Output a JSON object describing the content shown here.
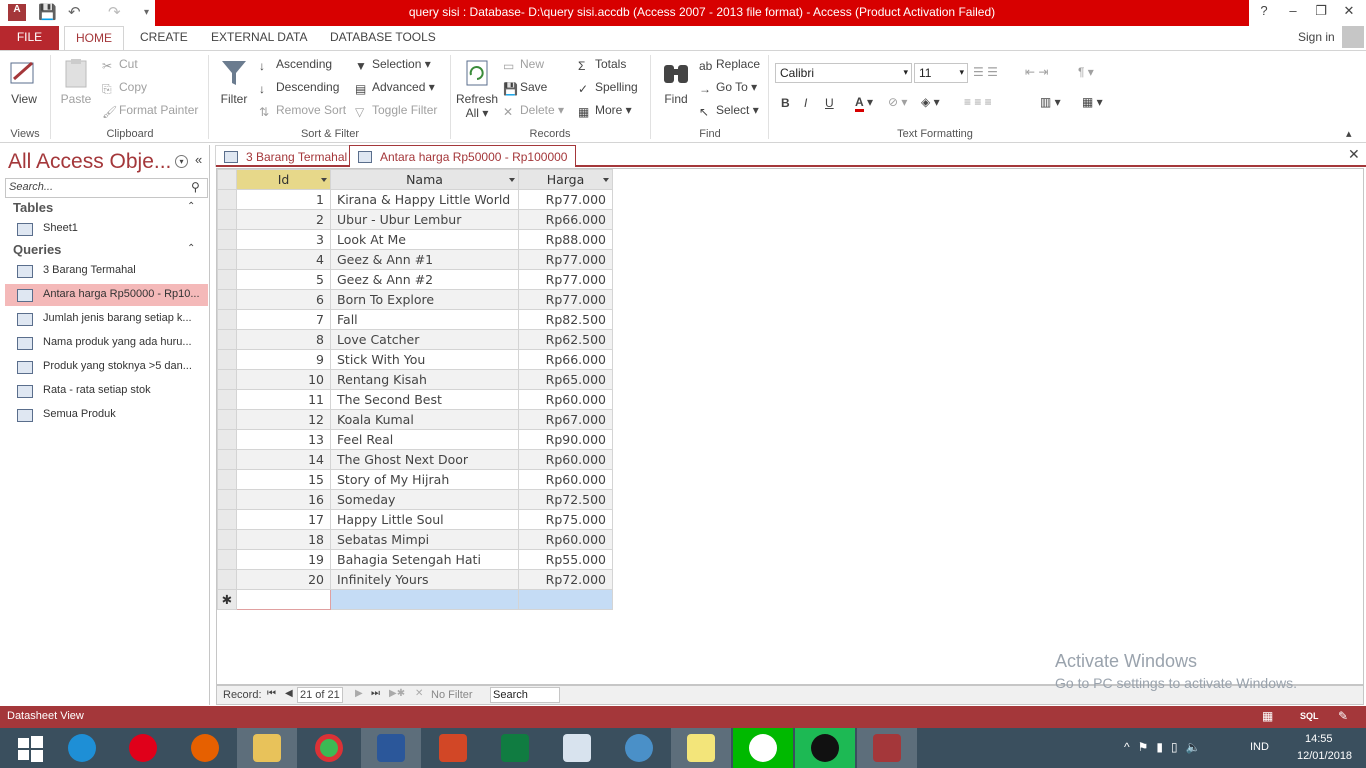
{
  "title_bar": {
    "title": "query sisi : Database- D:\\query sisi.accdb (Access 2007 - 2013 file format) -  Access (Product Activation Failed)",
    "help": "?",
    "minimize": "–",
    "restore": "❐",
    "close": "✕"
  },
  "tabs": {
    "file": "FILE",
    "home": "HOME",
    "create": "CREATE",
    "external": "EXTERNAL DATA",
    "dbtools": "DATABASE TOOLS",
    "signin": "Sign in"
  },
  "ribbon": {
    "views": {
      "view": "View",
      "label": "Views"
    },
    "clipboard": {
      "paste": "Paste",
      "cut": "Cut",
      "copy": "Copy",
      "format_painter": "Format Painter",
      "label": "Clipboard"
    },
    "sortfilter": {
      "filter": "Filter",
      "ascending": "Ascending",
      "descending": "Descending",
      "remove_sort": "Remove Sort",
      "selection": "Selection",
      "advanced": "Advanced",
      "toggle_filter": "Toggle Filter",
      "label": "Sort & Filter"
    },
    "records": {
      "refresh": "Refresh",
      "refresh_all": "All",
      "new": "New",
      "save": "Save",
      "delete": "Delete",
      "totals": "Totals",
      "spelling": "Spelling",
      "more": "More",
      "label": "Records"
    },
    "find": {
      "find": "Find",
      "replace": "Replace",
      "goto": "Go To",
      "select": "Select",
      "label": "Find"
    },
    "text": {
      "font": "Calibri",
      "size": "11",
      "bold": "B",
      "italic": "I",
      "underline": "U",
      "font_color": "A",
      "label": "Text Formatting"
    }
  },
  "nav": {
    "title": "All Access Obje...",
    "search_placeholder": "Search...",
    "tables_header": "Tables",
    "tables": [
      "Sheet1"
    ],
    "queries_header": "Queries",
    "queries": [
      "3 Barang Termahal",
      "Antara harga Rp50000 - Rp10...",
      "Jumlah jenis barang setiap k...",
      "Nama produk yang ada huru...",
      "Produk yang stoknya >5 dan...",
      "Rata - rata setiap stok",
      "Semua Produk"
    ]
  },
  "doc_tabs": [
    "3 Barang Termahal",
    "Antara harga Rp50000 - Rp100000"
  ],
  "datasheet": {
    "columns": [
      "Id",
      "Nama",
      "Harga"
    ],
    "rows": [
      [
        "1",
        "Kirana & Happy Little World",
        "Rp77.000"
      ],
      [
        "2",
        "Ubur - Ubur Lembur",
        "Rp66.000"
      ],
      [
        "3",
        "Look At Me",
        "Rp88.000"
      ],
      [
        "4",
        "Geez & Ann #1",
        "Rp77.000"
      ],
      [
        "5",
        "Geez & Ann #2",
        "Rp77.000"
      ],
      [
        "6",
        "Born To Explore",
        "Rp77.000"
      ],
      [
        "7",
        "Fall",
        "Rp82.500"
      ],
      [
        "8",
        "Love Catcher",
        "Rp62.500"
      ],
      [
        "9",
        "Stick With You",
        "Rp66.000"
      ],
      [
        "10",
        "Rentang Kisah",
        "Rp65.000"
      ],
      [
        "11",
        "The Second Best",
        "Rp60.000"
      ],
      [
        "12",
        "Koala Kumal",
        "Rp67.000"
      ],
      [
        "13",
        "Feel Real",
        "Rp90.000"
      ],
      [
        "14",
        "The Ghost Next Door",
        "Rp60.000"
      ],
      [
        "15",
        "Story of My Hijrah",
        "Rp60.000"
      ],
      [
        "16",
        "Someday",
        "Rp72.500"
      ],
      [
        "17",
        "Happy Little Soul",
        "Rp75.000"
      ],
      [
        "18",
        "Sebatas Mimpi",
        "Rp60.000"
      ],
      [
        "19",
        "Bahagia Setengah Hati",
        "Rp55.000"
      ],
      [
        "20",
        "Infinitely Yours",
        "Rp72.000"
      ]
    ],
    "new_row_marker": "✱"
  },
  "record_nav": {
    "label": "Record:",
    "position": "21 of 21",
    "filter": "No Filter",
    "search": "Search"
  },
  "status": {
    "text": "Datasheet View",
    "sql": "SQL"
  },
  "watermark": {
    "line1": "Activate Windows",
    "line2": "Go to PC settings to activate Windows."
  },
  "taskbar": {
    "lang": "IND",
    "time": "14:55",
    "date": "12/01/2018"
  },
  "colors": {
    "accent": "#a4373a",
    "titlebar": "#d70000",
    "taskbar": "#3a4f5e"
  }
}
